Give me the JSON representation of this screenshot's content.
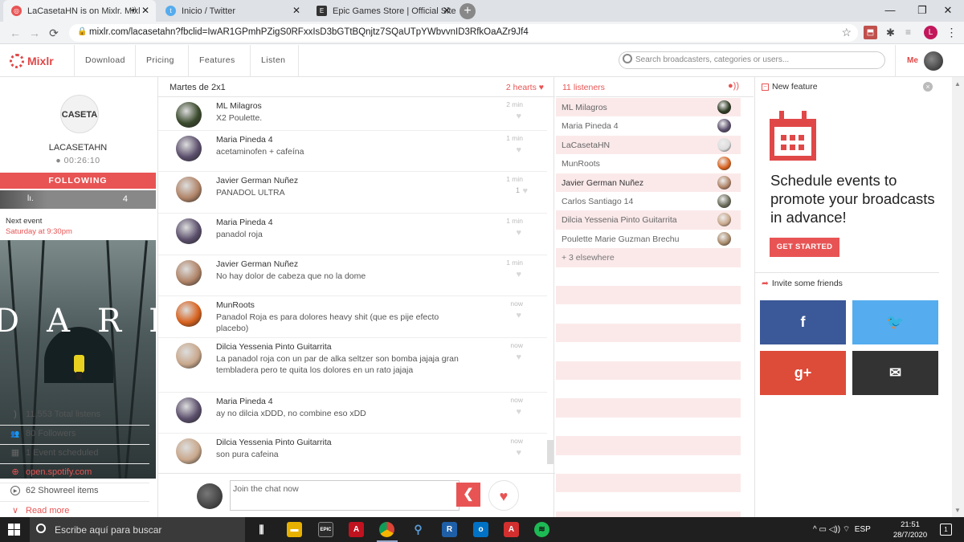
{
  "browser": {
    "tabs": [
      {
        "title": "LaCasetaHN is on Mixlr. Mixl",
        "icon": "mixlr-icon",
        "sound": "◂)",
        "close": "✕"
      },
      {
        "title": "Inicio / Twitter",
        "icon": "twitter-icon",
        "close": "✕"
      },
      {
        "title": "Epic Games Store | Official Site",
        "icon": "epic-icon",
        "close": "✕"
      }
    ],
    "new_tab": "+",
    "window_buttons": {
      "minimize": "—",
      "restore": "❐",
      "close": "✕"
    },
    "url": "mixlr.com/lacasetahn?fbclid=IwAR1GPmhPZigS0RFxxIsD3bGTtBQnjtz7SQaUTpYWbvvnID3RfkOaAZr9Jf4",
    "profile_initial": "L",
    "nav": {
      "back": "←",
      "forward": "→",
      "reload": "⟳",
      "star": "☆",
      "menu": "⋮"
    }
  },
  "site": {
    "logo": "Mixlr",
    "nav": [
      "Download",
      "Pricing",
      "Features",
      "Listen"
    ],
    "search_placeholder": "Search broadcasters, categories or users...",
    "me_label": "Me"
  },
  "channel": {
    "logo_text": "CASETA",
    "name": "LACASETAHN",
    "live_time": "● 00:26:10",
    "following_label": "FOLLOWING",
    "stat_bar_icon": "lı.",
    "stat_bar_count": "4",
    "next_event_label": "Next event",
    "next_event_time": "Saturday at 9:30pm",
    "poster_letters": "DARK",
    "stats": [
      {
        "icon": "listens-icon",
        "glyph": ")",
        "text": "11,553 Total listens"
      },
      {
        "icon": "followers-icon",
        "glyph": "👥",
        "text": "80 Followers"
      },
      {
        "icon": "calendar-icon",
        "glyph": "▦",
        "text": "1 Event scheduled"
      },
      {
        "icon": "globe-icon",
        "glyph": "⊕",
        "text": "open.spotify.com"
      },
      {
        "icon": "play-icon",
        "glyph": "▶",
        "text": "62 Showreel items"
      },
      {
        "icon": "chevron-down-icon",
        "glyph": "∨",
        "text": "Read more"
      }
    ]
  },
  "chat": {
    "title": "Martes de 2x1",
    "hearts": "2 hearts ♥",
    "messages": [
      {
        "name": "ML Milagros",
        "text": "X2 Poulette.",
        "time": "2 min",
        "count": "",
        "avatar": "#3a4a2c"
      },
      {
        "name": "Maria Pineda 4",
        "text": "acetaminofen + cafeína",
        "time": "1 min",
        "count": "",
        "avatar": "#5b4f6c"
      },
      {
        "name": "Javier German Nuñez",
        "text": "PANADOL ULTRA",
        "time": "1 min",
        "count": "1",
        "avatar": "#b08468"
      },
      {
        "name": "Maria Pineda 4",
        "text": "panadol roja",
        "time": "1 min",
        "count": "",
        "avatar": "#5b4f6c"
      },
      {
        "name": "Javier German Nuñez",
        "text": "No hay dolor de cabeza que no la dome",
        "time": "1 min",
        "count": "",
        "avatar": "#b08468"
      },
      {
        "name": "MunRoots",
        "text": "Panadol Roja es para dolores heavy shit (que es pije efecto placebo)",
        "time": "now",
        "count": "",
        "avatar": "#d8621e"
      },
      {
        "name": "Dilcia Yessenia Pinto Guitarrita",
        "text": "La panadol roja con un par de alka seltzer son bomba jajaja gran tembladera pero te quita los dolores en un rato jajaja",
        "time": "now",
        "count": "",
        "avatar": "#c9a88c"
      },
      {
        "name": "Maria Pineda 4",
        "text": "ay no dilcia xDDD, no combine eso xDD",
        "time": "now",
        "count": "",
        "avatar": "#5b4f6c"
      },
      {
        "name": "Dilcia Yessenia Pinto Guitarrita",
        "text": "son pura cafeina",
        "time": "now",
        "count": "",
        "avatar": "#c9a88c"
      }
    ],
    "input_placeholder": "Join the chat now",
    "send_label": "❮",
    "heart_label": "♥"
  },
  "listeners": {
    "count": "11 listeners",
    "icon": "●))",
    "items": [
      {
        "name": "ML Milagros",
        "avatar": "#2e3a22"
      },
      {
        "name": "Maria Pineda 4",
        "avatar": "#5b4f6c"
      },
      {
        "name": "LaCasetaHN",
        "avatar": "#dddddd"
      },
      {
        "name": "MunRoots",
        "avatar": "#d8621e"
      },
      {
        "name": "Javier German Nuñez",
        "avatar": "#b08468"
      },
      {
        "name": "Carlos Santiago 14",
        "avatar": "#6b6b5a"
      },
      {
        "name": "Dilcia Yessenia Pinto Guitarrita",
        "avatar": "#c9a88c"
      },
      {
        "name": "Poulette Marie Guzman Brechu",
        "avatar": "#a8896a"
      }
    ],
    "elsewhere": "+ 3 elsewhere"
  },
  "promo": {
    "new_feature": "New feature",
    "close": "×",
    "headline": "Schedule events to promote your broadcasts in advance!",
    "cta": "GET STARTED",
    "invite": "Invite some friends",
    "invite_arrow": "➦",
    "social": [
      {
        "label": "f",
        "color": "#3b5998",
        "icon": "facebook-icon"
      },
      {
        "label": "🐦",
        "color": "#55acee",
        "icon": "twitter-icon"
      },
      {
        "label": "g+",
        "color": "#dd4b39",
        "icon": "google-plus-icon"
      },
      {
        "label": "✉",
        "color": "#333333",
        "icon": "email-icon"
      }
    ]
  },
  "taskbar": {
    "search_text": "Escribe aquí para buscar",
    "language": "ESP",
    "time": "21:51",
    "date": "28/7/2020",
    "notifications": "1",
    "tray_icons": "^ ▭ ◁)) ⌔"
  }
}
